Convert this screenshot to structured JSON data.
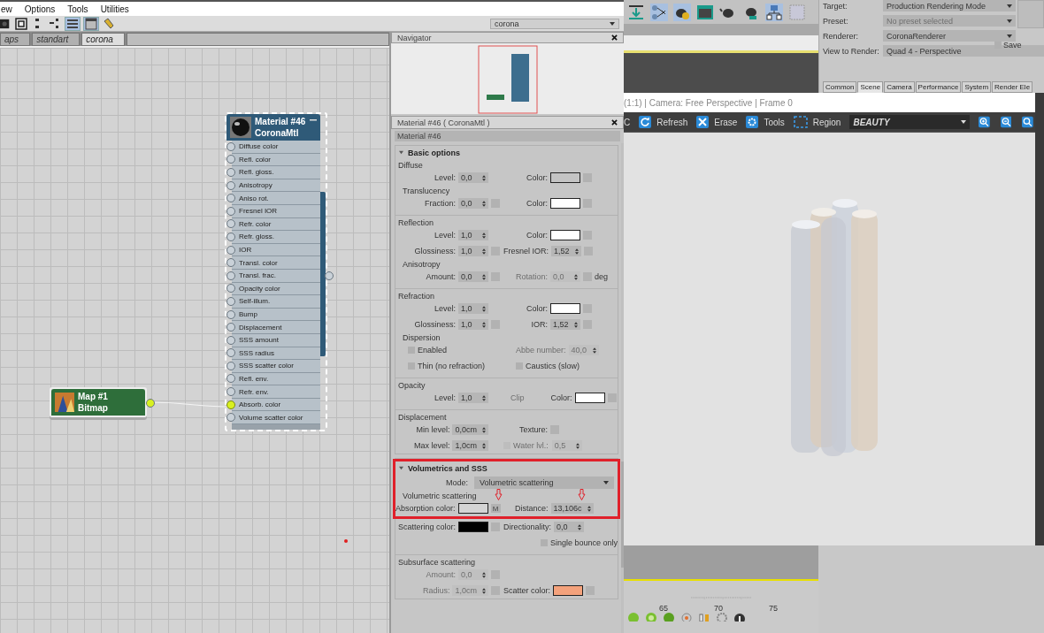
{
  "menu": [
    {
      "label": "ew"
    },
    {
      "label": "Options"
    },
    {
      "label": "Tools"
    },
    {
      "label": "Utilities"
    }
  ],
  "view_dropdown": {
    "value": "corona"
  },
  "editor_tabs": [
    {
      "label": "aps",
      "selected": false
    },
    {
      "label": "standart",
      "selected": false
    },
    {
      "label": "corona",
      "selected": true
    }
  ],
  "nodes": [
    {
      "kind": "material",
      "title": "Material #46",
      "subtitle": "CoronaMtl",
      "selected": true,
      "slots": [
        {
          "label": "Diffuse color",
          "connected": false
        },
        {
          "label": "Refl. color",
          "connected": false
        },
        {
          "label": "Refl. gloss.",
          "connected": false
        },
        {
          "label": "Anisotropy",
          "connected": false
        },
        {
          "label": "Aniso rot.",
          "connected": false
        },
        {
          "label": "Fresnel IOR",
          "connected": false
        },
        {
          "label": "Refr. color",
          "connected": false
        },
        {
          "label": "Refr. gloss.",
          "connected": false
        },
        {
          "label": "IOR",
          "connected": false
        },
        {
          "label": "Transl. color",
          "connected": false
        },
        {
          "label": "Transl. frac.",
          "connected": false
        },
        {
          "label": "Opacity color",
          "connected": false
        },
        {
          "label": "Self-illum.",
          "connected": false
        },
        {
          "label": "Bump",
          "connected": false
        },
        {
          "label": "Displacement",
          "connected": false
        },
        {
          "label": "SSS amount",
          "connected": false
        },
        {
          "label": "SSS radius",
          "connected": false
        },
        {
          "label": "SSS scatter color",
          "connected": false
        },
        {
          "label": "Refl. env.",
          "connected": false
        },
        {
          "label": "Refr. env.",
          "connected": false
        },
        {
          "label": "Absorb. color",
          "connected": true
        },
        {
          "label": "Volume scatter color",
          "connected": false
        }
      ]
    },
    {
      "kind": "map",
      "title": "Map #1",
      "subtitle": "Bitmap",
      "selected": false
    }
  ],
  "navigator": {
    "title": "Navigator"
  },
  "material_editor": {
    "title": "Material #46  ( CoronaMtl )",
    "name": "Material #46",
    "sections": [
      {
        "items": [
          {
            "kind": "title",
            "text": "Basic options",
            "expanded": true
          },
          {
            "kind": "heading",
            "text": "Diffuse"
          },
          {
            "kind": "fields",
            "cells": [
              {
                "kind": "spinner",
                "label": "Level:",
                "value": "0,0",
                "disabled": false
              },
              {
                "kind": "color",
                "label": "Color:",
                "color": "#c4c4c4",
                "map": true
              }
            ]
          },
          {
            "kind": "subheading",
            "text": "Translucency"
          },
          {
            "kind": "fields",
            "cells": [
              {
                "kind": "spinner",
                "label": "Fraction:",
                "value": "0,0",
                "disabled": false,
                "map": true
              },
              {
                "kind": "color",
                "label": "Color:",
                "color": "#ffffff",
                "map": true
              }
            ]
          },
          {
            "kind": "heading",
            "text": "Reflection"
          },
          {
            "kind": "fields",
            "cells": [
              {
                "kind": "spinner",
                "label": "Level:",
                "value": "1,0",
                "disabled": false
              },
              {
                "kind": "color",
                "label": "Color:",
                "color": "#ffffff",
                "map": true
              }
            ]
          },
          {
            "kind": "fields",
            "cells": [
              {
                "kind": "spinner",
                "label": "Glossiness:",
                "value": "1,0",
                "disabled": false,
                "map": true
              },
              {
                "kind": "spinner",
                "label": "Fresnel IOR:",
                "value": "1,52",
                "disabled": false,
                "map": true
              }
            ]
          },
          {
            "kind": "subheading",
            "text": "Anisotropy"
          },
          {
            "kind": "fields",
            "cells": [
              {
                "kind": "spinner",
                "label": "Amount:",
                "value": "0,0",
                "disabled": false,
                "map": true
              },
              {
                "kind": "spinner",
                "label": "Rotation:",
                "value": "0,0",
                "disabled": true,
                "map": true,
                "unit": "deg"
              }
            ]
          },
          {
            "kind": "heading",
            "text": "Refraction"
          },
          {
            "kind": "fields",
            "cells": [
              {
                "kind": "spinner",
                "label": "Level:",
                "value": "1,0",
                "disabled": false
              },
              {
                "kind": "color",
                "label": "Color:",
                "color": "#ffffff",
                "map": true
              }
            ]
          },
          {
            "kind": "fields",
            "cells": [
              {
                "kind": "spinner",
                "label": "Glossiness:",
                "value": "1,0",
                "disabled": false,
                "map": true
              },
              {
                "kind": "spinner",
                "label": "IOR:",
                "value": "1,52",
                "disabled": false,
                "map": true
              }
            ]
          },
          {
            "kind": "subheading",
            "text": "Dispersion"
          },
          {
            "kind": "fields",
            "cells": [
              {
                "kind": "check",
                "label": "Enabled",
                "checked": false,
                "disabled": false
              },
              {
                "kind": "spinner",
                "label": "Abbe number:",
                "value": "40,0",
                "disabled": true
              }
            ]
          },
          {
            "kind": "fields",
            "cells": [
              {
                "kind": "check",
                "label": "Thin (no refraction)",
                "checked": false,
                "disabled": false
              },
              {
                "kind": "check",
                "label": "Caustics (slow)",
                "checked": false,
                "disabled": false
              }
            ]
          },
          {
            "kind": "heading",
            "text": "Opacity"
          },
          {
            "kind": "fields",
            "cells": [
              {
                "kind": "spinner",
                "label": "Level:",
                "value": "1,0",
                "disabled": false
              },
              {
                "kind": "text",
                "label": "Clip",
                "disabled": true
              },
              {
                "kind": "color",
                "label": "Color:",
                "color": "#ffffff",
                "map": true
              }
            ]
          },
          {
            "kind": "heading",
            "text": "Displacement"
          },
          {
            "kind": "fields",
            "cells": [
              {
                "kind": "spinner",
                "label": "Min level:",
                "value": "0,0cm",
                "disabled": false
              },
              {
                "kind": "mapbtn",
                "label": "Texture:"
              }
            ]
          },
          {
            "kind": "fields",
            "cells": [
              {
                "kind": "spinner",
                "label": "Max level:",
                "value": "1,0cm",
                "disabled": false
              },
              {
                "kind": "check",
                "label": "Water lvl.:",
                "checked": false,
                "disabled": true
              },
              {
                "kind": "spinner",
                "value": "0,5",
                "disabled": true
              }
            ]
          }
        ]
      },
      {
        "items": [
          {
            "kind": "title",
            "text": "Volumetrics and SSS",
            "expanded": true,
            "highlighted": true
          },
          {
            "kind": "fields",
            "highlighted": true,
            "cells": [
              {
                "kind": "dropdown",
                "label": "Mode:",
                "value": "Volumetric scattering"
              }
            ]
          },
          {
            "kind": "subheading",
            "text": "Volumetric scattering",
            "highlighted": true
          },
          {
            "kind": "fields",
            "highlighted": true,
            "cells": [
              {
                "kind": "color",
                "label": "Absorption color:",
                "color": "#d4d4d4",
                "map": true,
                "map_label": "M"
              },
              {
                "kind": "spinner",
                "label": "Distance:",
                "value": "13,106c",
                "disabled": false
              }
            ]
          },
          {
            "kind": "fields",
            "cells": [
              {
                "kind": "color",
                "label": "Scattering color:",
                "color": "#000000",
                "map": true
              },
              {
                "kind": "spinner",
                "label": "Directionality:",
                "value": "0,0",
                "disabled": false
              }
            ]
          },
          {
            "kind": "fields",
            "cells": [
              {
                "kind": "check",
                "label": "Single bounce only",
                "checked": false,
                "disabled": false
              }
            ]
          },
          {
            "kind": "heading",
            "text": "Subsurface scattering"
          },
          {
            "kind": "fields",
            "cells": [
              {
                "kind": "spinner",
                "label": "Amount:",
                "value": "0,0",
                "disabled": true,
                "map": true
              }
            ]
          },
          {
            "kind": "fields",
            "cells": [
              {
                "kind": "spinner",
                "label": "Radius:",
                "value": "1,0cm",
                "disabled": true,
                "map": true
              },
              {
                "kind": "color",
                "label": "Scatter color:",
                "color": "#f4a27c",
                "map": true
              }
            ]
          }
        ]
      }
    ]
  },
  "render_setup": {
    "rows": [
      {
        "label": "Target:",
        "value": "Production Rendering Mode",
        "disabled": false
      },
      {
        "label": "Preset:",
        "value": "No preset selected",
        "disabled": true
      },
      {
        "label": "Renderer:",
        "value": "CoronaRenderer",
        "disabled": false
      },
      {
        "label": "View to Render:",
        "value": "Quad 4 - Perspective",
        "disabled": false
      }
    ],
    "save": {
      "label": "Save",
      "checked": false
    },
    "tabs": [
      {
        "label": "Common",
        "selected": false
      },
      {
        "label": "Scene",
        "selected": true
      },
      {
        "label": "Camera",
        "selected": false
      },
      {
        "label": "Performance",
        "selected": false
      },
      {
        "label": "System",
        "selected": false
      },
      {
        "label": "Render Ele",
        "selected": false
      }
    ]
  },
  "frame_window": {
    "title": "(1:1) | Camera: Free Perspective | Frame 0",
    "toolbar": [
      {
        "kind": "text",
        "label": "C"
      },
      {
        "kind": "refresh",
        "label": "Refresh"
      },
      {
        "kind": "erase",
        "label": "Erase"
      },
      {
        "kind": "tools",
        "label": "Tools"
      },
      {
        "kind": "region",
        "label": "Region"
      }
    ],
    "channel": "BEAUTY"
  },
  "timeline": {
    "labels": [
      "65",
      "70",
      "75"
    ]
  }
}
